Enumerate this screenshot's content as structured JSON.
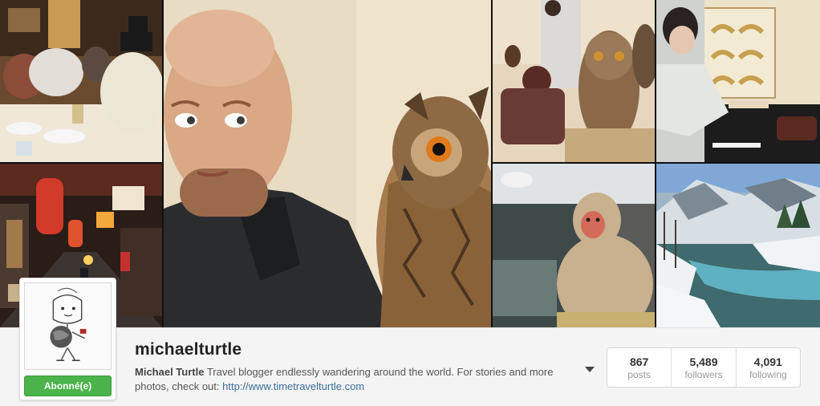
{
  "profile": {
    "username": "michaelturtle",
    "full_name": "Michael Turtle",
    "bio_text": " Travel blogger endlessly wandering around the world. For stories and more photos, check out: ",
    "website": "http://www.timetravelturtle.com",
    "follow_button_label": "Abonné(e)"
  },
  "stats": [
    {
      "value": "867",
      "label": "posts"
    },
    {
      "value": "5,489",
      "label": "followers"
    },
    {
      "value": "4,091",
      "label": "following"
    }
  ],
  "photos": [
    {
      "subject": "izakaya-moomin-plush-photo"
    },
    {
      "subject": "tokyo-alley-lanterns-photo"
    },
    {
      "subject": "man-with-owl-selfie-photo"
    },
    {
      "subject": "owl-cafe-photo"
    },
    {
      "subject": "kaiseki-dining-photo"
    },
    {
      "subject": "snow-monkey-photo"
    },
    {
      "subject": "snowy-river-valley-photo"
    }
  ],
  "colors": {
    "follow_green": "#4ab34a",
    "link_blue": "#3b6d99",
    "background": "#f4f4f4"
  }
}
